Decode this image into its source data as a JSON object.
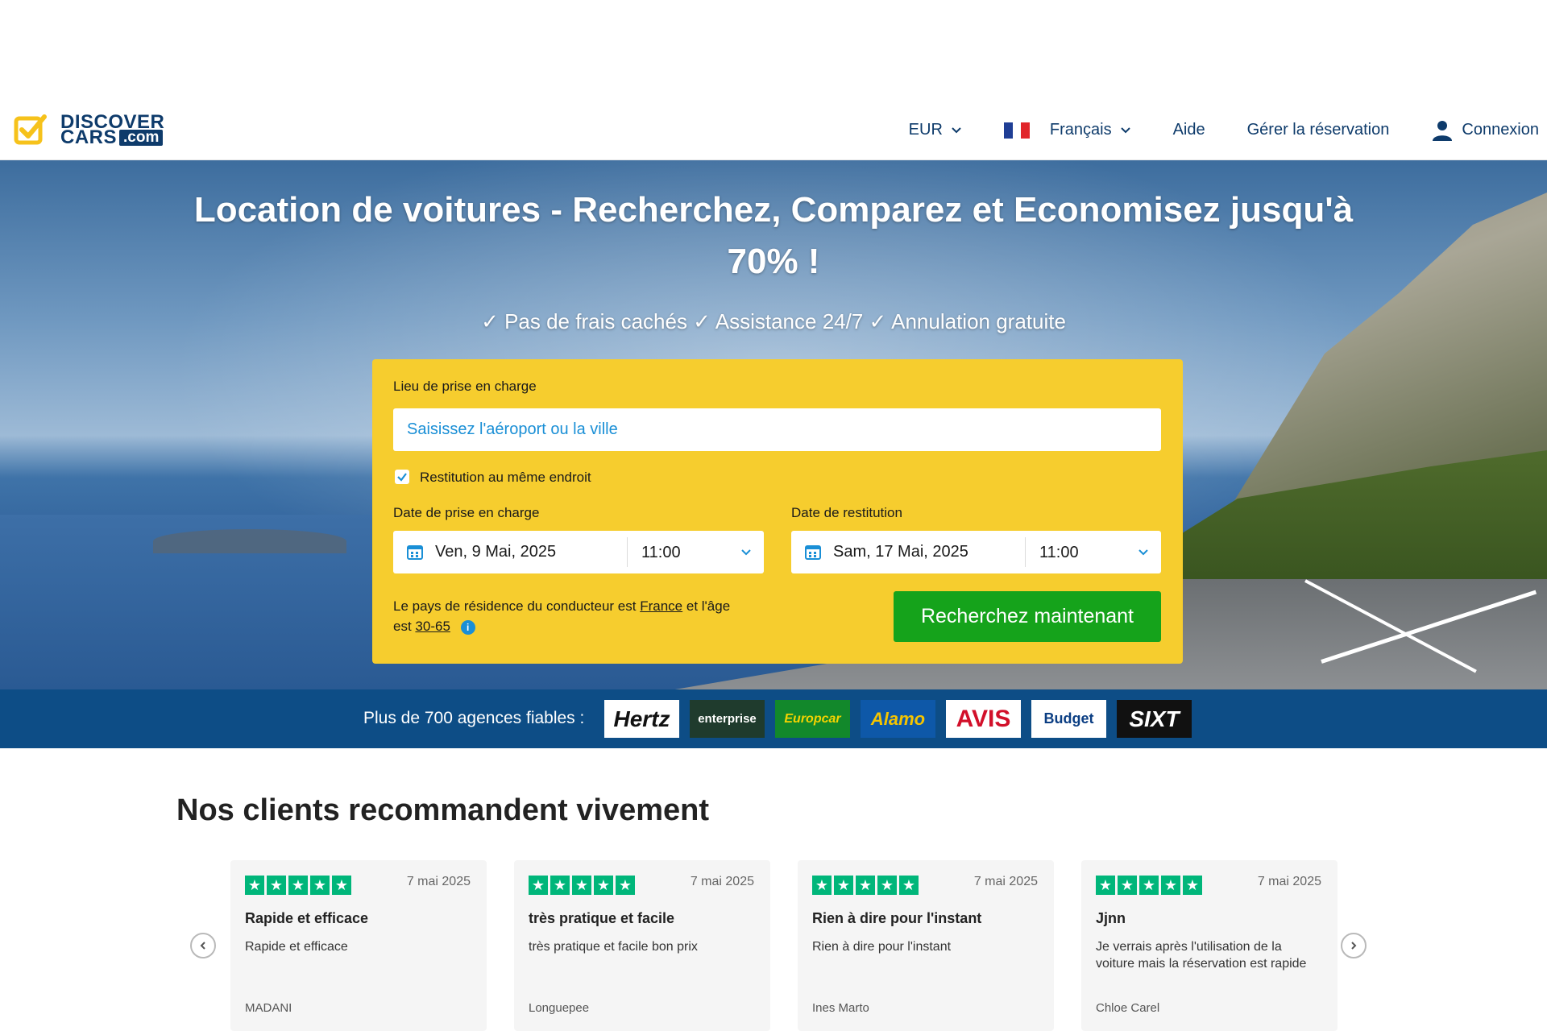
{
  "header": {
    "logo": {
      "line1": "DISCOVER",
      "line2": "CARS",
      "suffix": ".com"
    },
    "nav": {
      "currency": "EUR",
      "language": "Français",
      "help": "Aide",
      "manage": "Gérer la réservation",
      "login": "Connexion"
    },
    "icons": {
      "flag": "france-flag-icon",
      "user": "user-icon",
      "chevron": "chevron-down-icon"
    }
  },
  "hero": {
    "title": "Location de voitures - Recherchez, Comparez et Economisez jusqu'à 70% !",
    "subtitle": "✓ Pas de frais cachés ✓ Assistance 24/7 ✓ Annulation gratuite"
  },
  "search": {
    "pickup_label": "Lieu de prise en charge",
    "pickup_placeholder": "Saisissez l'aéroport ou la ville",
    "same_return_label": "Restitution au même endroit",
    "same_return_checked": true,
    "pickup_date_label": "Date de prise en charge",
    "pickup_date": "Ven, 9 Mai, 2025",
    "pickup_time": "11:00",
    "return_date_label": "Date de restitution",
    "return_date": "Sam, 17 Mai, 2025",
    "return_time": "11:00",
    "residence_prefix": "Le pays de résidence du conducteur est",
    "residence_country": "France",
    "residence_mid": "et l'âge est",
    "residence_age": "30-65",
    "button": "Recherchez maintenant"
  },
  "brands": {
    "label": "Plus de 700 agences fiables :",
    "items": [
      {
        "name": "Hertz",
        "bg": "#ffffff",
        "fg": "#111111"
      },
      {
        "name": "enterprise",
        "bg": "#1f3b2d",
        "fg": "#ffffff"
      },
      {
        "name": "Europcar",
        "bg": "#12882b",
        "fg": "#f5d300"
      },
      {
        "name": "Alamo",
        "bg": "#0e58a8",
        "fg": "#f5c400"
      },
      {
        "name": "AVIS",
        "bg": "#ffffff",
        "fg": "#d2102a"
      },
      {
        "name": "Budget",
        "bg": "#ffffff",
        "fg": "#0b3e83"
      },
      {
        "name": "SIXT",
        "bg": "#111111",
        "fg": "#ffffff"
      }
    ]
  },
  "reviews": {
    "title": "Nos clients recommandent vivement",
    "items": [
      {
        "date": "7 mai 2025",
        "title": "Rapide et efficace",
        "text": "Rapide et efficace",
        "author": "MADANI"
      },
      {
        "date": "7 mai 2025",
        "title": "très pratique et facile",
        "text": "très pratique et facile bon prix",
        "author": "Longuepee"
      },
      {
        "date": "7 mai 2025",
        "title": "Rien à dire pour l'instant",
        "text": "Rien à dire pour l'instant",
        "author": "Ines Marto"
      },
      {
        "date": "7 mai 2025",
        "title": "Jjnn",
        "text": "Je verrais après l'utilisation de la voiture mais la réservation est rapide",
        "author": "Chloe Carel"
      }
    ]
  },
  "colors": {
    "accent": "#f6cd2e",
    "cta": "#15a31b",
    "brand": "#0e3b6b",
    "trustpilot": "#00b67a"
  }
}
